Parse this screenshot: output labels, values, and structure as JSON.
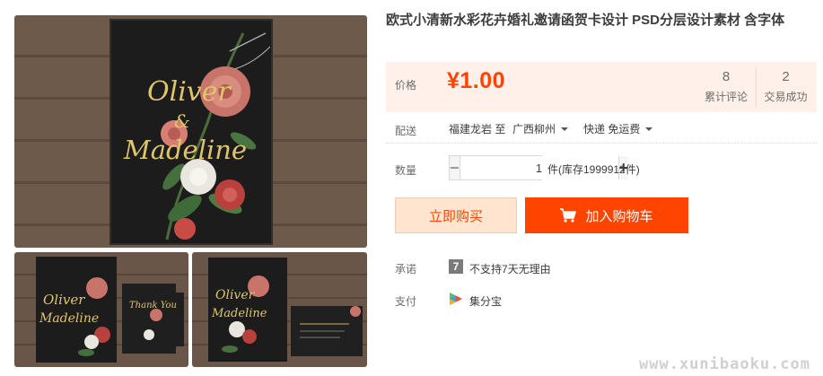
{
  "product": {
    "title": "欧式小清新水彩花卉婚礼邀请函贺卡设计 PSD分层设计素材 含字体"
  },
  "gallery": {
    "main_card_script_1": "Oliver",
    "main_card_amp": "&",
    "main_card_script_2": "Madeline",
    "thumb1_script_1": "Oliver",
    "thumb1_script_2": "Madeline",
    "thumb1_small_card": "Thank You",
    "thumb2_script_1": "Oliver",
    "thumb2_script_2": "Madeline"
  },
  "price": {
    "label": "价格",
    "value": "¥1.00",
    "reviews_count": "8",
    "reviews_label": "累计评论",
    "deals_count": "2",
    "deals_label": "交易成功"
  },
  "shipping": {
    "label": "配送",
    "from": "福建龙岩 至",
    "to": "广西柳州",
    "method": "快递 免运费"
  },
  "quantity": {
    "label": "数量",
    "minus": "−",
    "value": "1",
    "plus": "+",
    "stock": "件(库存1999912件)"
  },
  "actions": {
    "buy_now": "立即购买",
    "add_cart": "加入购物车"
  },
  "promise": {
    "label": "承诺",
    "badge": "7",
    "text": "不支持7天无理由"
  },
  "payment": {
    "label": "支付",
    "text": "集分宝"
  },
  "watermark": "www.xunibaoku.com",
  "colors": {
    "accent": "#ff4400",
    "price_bg": "#fff1e9",
    "buy_bg": "#ffe4d0"
  }
}
